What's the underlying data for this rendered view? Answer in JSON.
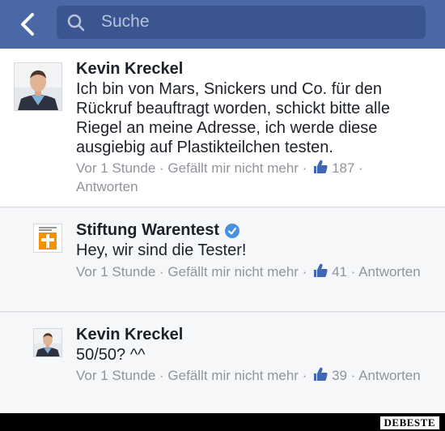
{
  "header": {
    "search_placeholder": "Suche"
  },
  "comments": [
    {
      "author": "Kevin Kreckel",
      "text": "Ich bin von Mars, Snickers und Co. für den Rückruf beauftragt worden, schickt bitte alle Riegel an meine Adresse, ich werde diese ausgiebig auf Plastikteilchen testen.",
      "time": "Vor 1 Stunde",
      "like_action": "Gefällt mir nicht mehr",
      "like_count": "187",
      "reply": "Antworten"
    },
    {
      "author": "Stiftung Warentest",
      "verified": true,
      "text": "Hey, wir sind die Tester!",
      "time": "Vor 1 Stunde",
      "like_action": "Gefällt mir nicht mehr",
      "like_count": "41",
      "reply": "Antworten"
    },
    {
      "author": "Kevin Kreckel",
      "text": "50/50? ^^",
      "time": "Vor 1 Stunde",
      "like_action": "Gefällt mir nicht mehr",
      "like_count": "39",
      "reply": "Antworten"
    }
  ],
  "watermark": "DEBESTE",
  "colors": {
    "header": "#4a67a6",
    "search_box": "#3b5590",
    "like_blue": "#4267b2",
    "verified_blue": "#4a90e2",
    "warentest_orange": "#f39200"
  }
}
